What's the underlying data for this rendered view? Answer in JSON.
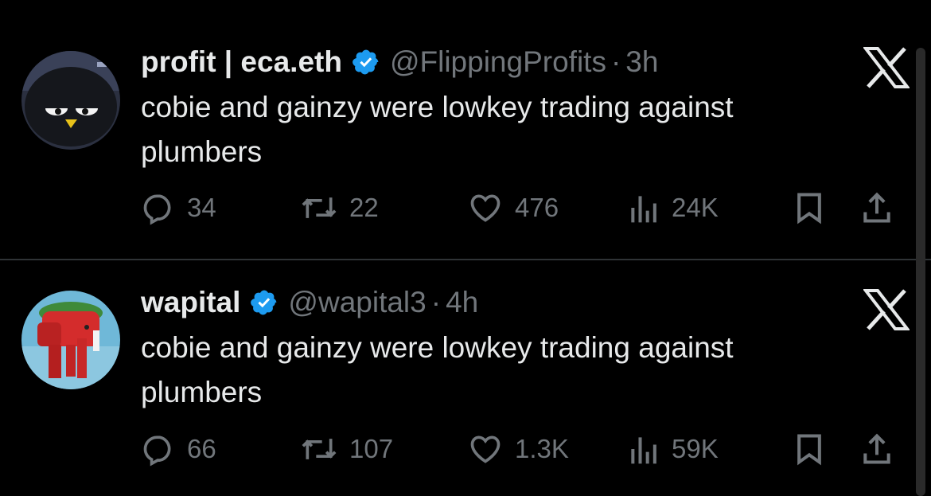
{
  "tweets": [
    {
      "display_name": "profit | eca.eth",
      "handle": "@FlippingProfits",
      "separator": "·",
      "time": "3h",
      "text": "cobie and gainzy were lowkey trading against plumbers",
      "replies": "34",
      "reposts": "22",
      "likes": "476",
      "views": "24K"
    },
    {
      "display_name": "wapital",
      "handle": "@wapital3",
      "separator": "·",
      "time": "4h",
      "text": "cobie and gainzy were lowkey trading against plumbers",
      "replies": "66",
      "reposts": "107",
      "likes": "1.3K",
      "views": "59K"
    }
  ],
  "icons": {
    "verified": "verified-badge-icon",
    "brand": "x-logo-icon",
    "reply": "reply-icon",
    "repost": "repost-icon",
    "like": "heart-icon",
    "views": "views-icon",
    "bookmark": "bookmark-icon",
    "share": "share-icon"
  },
  "colors": {
    "background": "#000000",
    "text": "#e7e9ea",
    "muted": "#71767b",
    "verified": "#1d9bf0",
    "divider": "#2f3336"
  }
}
